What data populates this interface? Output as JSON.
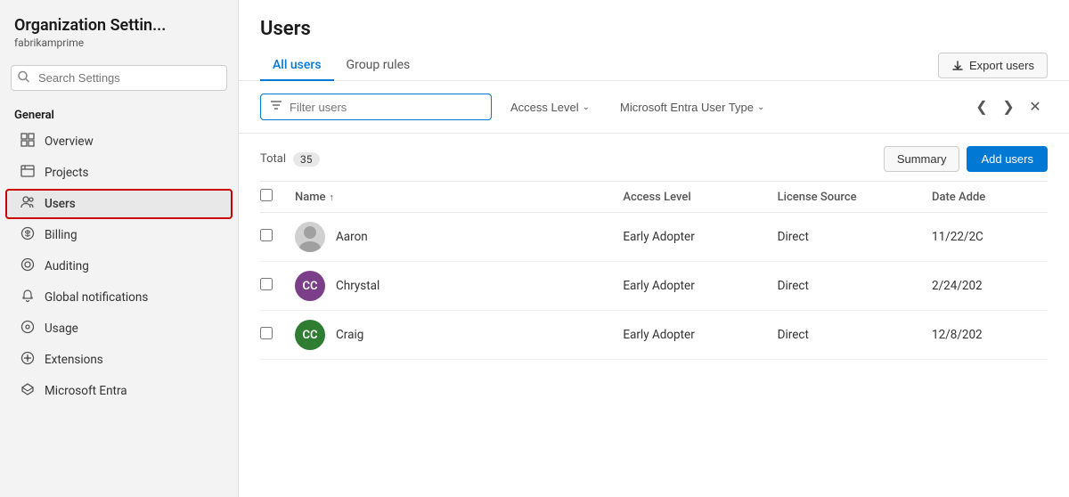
{
  "sidebar": {
    "title": "Organization Settin...",
    "subtitle": "fabrikamprime",
    "search_placeholder": "Search Settings",
    "section_general": "General",
    "items": [
      {
        "id": "overview",
        "label": "Overview",
        "icon": "⊞"
      },
      {
        "id": "projects",
        "label": "Projects",
        "icon": "⊕"
      },
      {
        "id": "users",
        "label": "Users",
        "icon": "👥",
        "active": true
      },
      {
        "id": "billing",
        "label": "Billing",
        "icon": "🛒"
      },
      {
        "id": "auditing",
        "label": "Auditing",
        "icon": "◎"
      },
      {
        "id": "global-notifications",
        "label": "Global notifications",
        "icon": "🔔"
      },
      {
        "id": "usage",
        "label": "Usage",
        "icon": "⊙"
      },
      {
        "id": "extensions",
        "label": "Extensions",
        "icon": "⊗"
      },
      {
        "id": "microsoft-entra",
        "label": "Microsoft Entra",
        "icon": "◇"
      }
    ]
  },
  "main": {
    "title": "Users",
    "tabs": [
      {
        "id": "all-users",
        "label": "All users",
        "active": true
      },
      {
        "id": "group-rules",
        "label": "Group rules",
        "active": false
      }
    ],
    "export_button": "Export users",
    "filter": {
      "placeholder": "Filter users",
      "access_level_label": "Access Level",
      "entra_user_type_label": "Microsoft Entra User Type"
    },
    "toolbar": {
      "total_label": "Total",
      "total_count": "35",
      "summary_label": "Summary",
      "add_users_label": "Add users"
    },
    "table": {
      "columns": [
        {
          "id": "name",
          "label": "Name",
          "sortable": true
        },
        {
          "id": "access-level",
          "label": "Access Level"
        },
        {
          "id": "license-source",
          "label": "License Source"
        },
        {
          "id": "date-added",
          "label": "Date Adde"
        }
      ],
      "rows": [
        {
          "id": "aaron",
          "name": "Aaron",
          "avatar_initials": "",
          "avatar_type": "photo",
          "access_level": "Early Adopter",
          "license_source": "Direct",
          "date_added": "11/22/2C"
        },
        {
          "id": "chrystal",
          "name": "Chrystal",
          "avatar_initials": "CC",
          "avatar_type": "initials",
          "avatar_bg": "#7b3f8a",
          "access_level": "Early Adopter",
          "license_source": "Direct",
          "date_added": "2/24/202"
        },
        {
          "id": "craig",
          "name": "Craig",
          "avatar_initials": "CC",
          "avatar_type": "initials",
          "avatar_bg": "#2e7d32",
          "access_level": "Early Adopter",
          "license_source": "Direct",
          "date_added": "12/8/202"
        }
      ]
    }
  }
}
